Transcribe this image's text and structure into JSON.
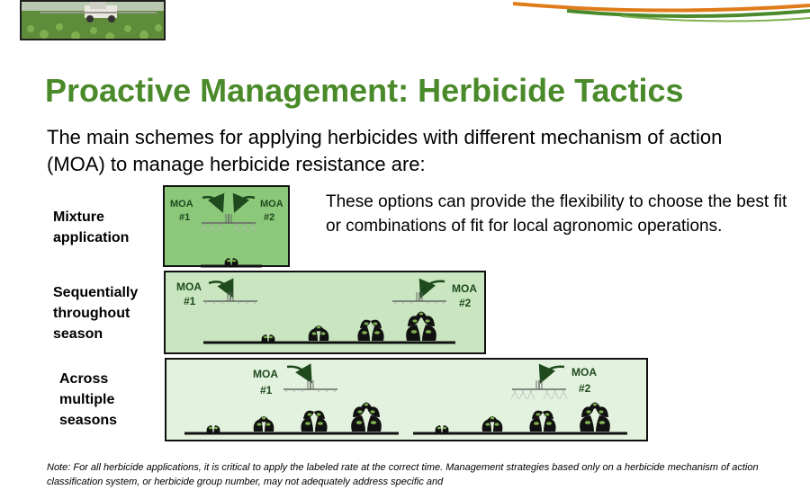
{
  "title": "Proactive Management: Herbicide Tactics",
  "intro": "The main schemes for applying herbicides with different mechanism of action (MOA) to manage herbicide resistance are:",
  "options_text": "These options can provide the flexibility to choose the best fit or combinations of fit for local agronomic operations.",
  "labels": {
    "mixture": "Mixture application",
    "sequential": "Sequentially throughout season",
    "across": "Across multiple seasons"
  },
  "moa": {
    "moa_text": "MOA",
    "num1": "#1",
    "num2": "#2"
  },
  "note": "Note: For all herbicide applications, it is critical to apply the labeled rate at the correct time. Management strategies based only on a herbicide mechanism of action classification system, or herbicide group number, may not adequately address specific and",
  "colors": {
    "title_green": "#4a8a2a",
    "panel_mixture": "#8cc87a",
    "panel_sequential": "#c9e6c0",
    "panel_across": "#e3f2de",
    "swoosh_orange": "#e07b1a",
    "swoosh_green": "#4a8a2a"
  }
}
